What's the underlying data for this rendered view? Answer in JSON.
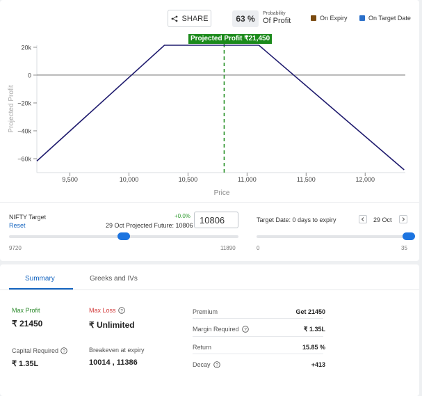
{
  "toolbar": {
    "share_label": "SHARE",
    "pop_value": "63 %",
    "pop_small": "Probability",
    "pop_big": "Of Profit",
    "legend": [
      {
        "label": "On Expiry",
        "color": "#7a4a10"
      },
      {
        "label": "On Target Date",
        "color": "#2a6fc9"
      }
    ]
  },
  "projected_label": "Projected Profit ₹21,450",
  "chart_data": {
    "type": "line",
    "xlabel": "Price",
    "ylabel": "Projected Profit",
    "x_ticks": [
      9500,
      10000,
      10500,
      11000,
      11500,
      12000
    ],
    "x_tick_labels": [
      "9,500",
      "10,000",
      "10,500",
      "11,000",
      "11,500",
      "12,000"
    ],
    "y_ticks": [
      20000,
      0,
      -20000,
      -40000,
      -60000
    ],
    "y_tick_labels": [
      "20k",
      "0",
      "−20k",
      "−40k",
      "−60k"
    ],
    "xlim": [
      9220,
      12340
    ],
    "ylim": [
      -68000,
      21450
    ],
    "series": [
      {
        "color": "#1f1b6e",
        "points": [
          [
            9220,
            -61700
          ],
          [
            10300,
            21450
          ],
          [
            11100,
            21450
          ],
          [
            12330,
            -68000
          ]
        ]
      }
    ],
    "target_line": {
      "x": 10806,
      "color": "#1b8a1b"
    },
    "grid": false
  },
  "controls": {
    "nifty_title": "NIFTY Target",
    "reset_label": "Reset",
    "pct_change": "+0.0%",
    "projected_future": "29 Oct Projected Future: 10806",
    "target_value": "10806",
    "slider_min": "9720",
    "slider_max": "11890",
    "slider_position": 0.5,
    "target_date_label": "Target Date: 0 days to expiry",
    "date_value": "29 Oct",
    "days_min": "0",
    "days_max": "35",
    "days_position": 1.0
  },
  "tabs": [
    {
      "label": "Summary",
      "active": true
    },
    {
      "label": "Greeks and IVs",
      "active": false
    }
  ],
  "summary": {
    "max_profit_label": "Max Profit",
    "max_profit_value": "₹ 21450",
    "max_profit_color": "#2e8b2e",
    "max_loss_label": "Max Loss",
    "max_loss_value": "₹ Unlimited",
    "max_loss_color": "#d23a3a",
    "capital_label": "Capital Required",
    "capital_value": "₹ 1.35L",
    "breakeven_label": "Breakeven at expiry",
    "breakeven_value": "10014 , 11386"
  },
  "details": [
    {
      "label": "Premium",
      "value": "Get 21450"
    },
    {
      "label": "Margin Required",
      "value": "₹ 1.35L"
    },
    {
      "label": "Return",
      "value": "15.85 %"
    },
    {
      "label": "Decay",
      "value": "+413"
    }
  ]
}
